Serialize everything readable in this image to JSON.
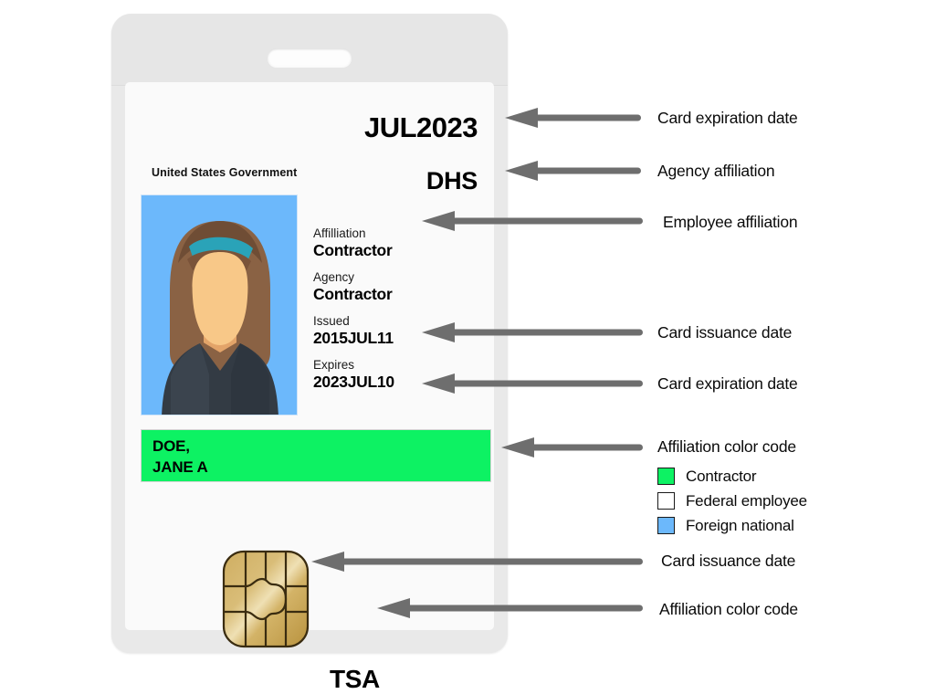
{
  "card": {
    "us_government_label": "United States Government",
    "expiry_large": "JUL2023",
    "agency_large": "DHS",
    "fields": [
      {
        "label": "Affilliation",
        "value": "Contractor"
      },
      {
        "label": "Agency",
        "value": "Contractor"
      },
      {
        "label": "Issued",
        "value": "2015JUL11"
      },
      {
        "label": "Expires",
        "value": "2023JUL10"
      }
    ],
    "name_line1": "DOE,",
    "name_line2": "JANE A",
    "tsa_label": "TSA",
    "photo_alt": "employee-photo",
    "name_bar_color": "#0df263",
    "photo_background_color": "#6cb8fb",
    "chip_color": "#c8a34b"
  },
  "annotations": [
    {
      "text": "Card expiration date"
    },
    {
      "text": "Agency affiliation"
    },
    {
      "text": "Employee affiliation"
    },
    {
      "text": "Card issuance date"
    },
    {
      "text": "Card expiration date"
    },
    {
      "text": "Affiliation color code"
    },
    {
      "text": "Card issuance date"
    },
    {
      "text": "Affiliation color code"
    }
  ],
  "legend": {
    "items": [
      {
        "label": "Contractor",
        "color": "#0df263"
      },
      {
        "label": "Federal employee",
        "color": "#ffffff"
      },
      {
        "label": "Foreign national",
        "color": "#6cb8fb"
      }
    ]
  },
  "colors": {
    "arrow": "#6e6e6e",
    "holder": "#e9e9e9",
    "card": "#fafafa"
  }
}
